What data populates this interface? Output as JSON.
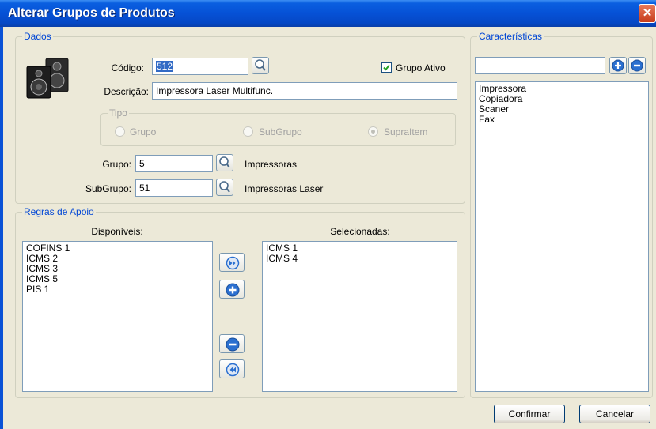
{
  "window": {
    "title": "Alterar Grupos de Produtos",
    "close_glyph": "✕"
  },
  "dados": {
    "legend": "Dados",
    "icon": "speakers-icon",
    "codigo_label": "Código:",
    "codigo_value": "512",
    "grupo_ativo_label": "Grupo Ativo",
    "grupo_ativo_checked": true,
    "descricao_label": "Descrição:",
    "descricao_value": "Impressora Laser Multifunc.",
    "tipo": {
      "legend": "Tipo",
      "options": [
        "Grupo",
        "SubGrupo",
        "SupraItem"
      ],
      "selected": "SupraItem",
      "enabled": false
    },
    "grupo_label": "Grupo:",
    "grupo_value": "5",
    "grupo_desc": "Impressoras",
    "subgrupo_label": "SubGrupo:",
    "subgrupo_value": "51",
    "subgrupo_desc": "Impressoras Laser"
  },
  "regras": {
    "legend": "Regras de Apoio",
    "disponiveis_label": "Disponíveis:",
    "disponiveis": [
      "COFINS 1",
      "ICMS 2",
      "ICMS 3",
      "ICMS 5",
      "PIS 1"
    ],
    "selecionadas_label": "Selecionadas:",
    "selecionadas": [
      "ICMS 1",
      "ICMS 4"
    ]
  },
  "caracteristicas": {
    "legend": "Características",
    "input_value": "",
    "items": [
      "Impressora",
      "Copiadora",
      "Scaner",
      "Fax"
    ]
  },
  "footer": {
    "confirm_label": "Confirmar",
    "cancel_label": "Cancelar"
  },
  "colors": {
    "title_bar": "#0651d6",
    "legend_text": "#0046d5",
    "button_icon": "#2a6fd0"
  }
}
